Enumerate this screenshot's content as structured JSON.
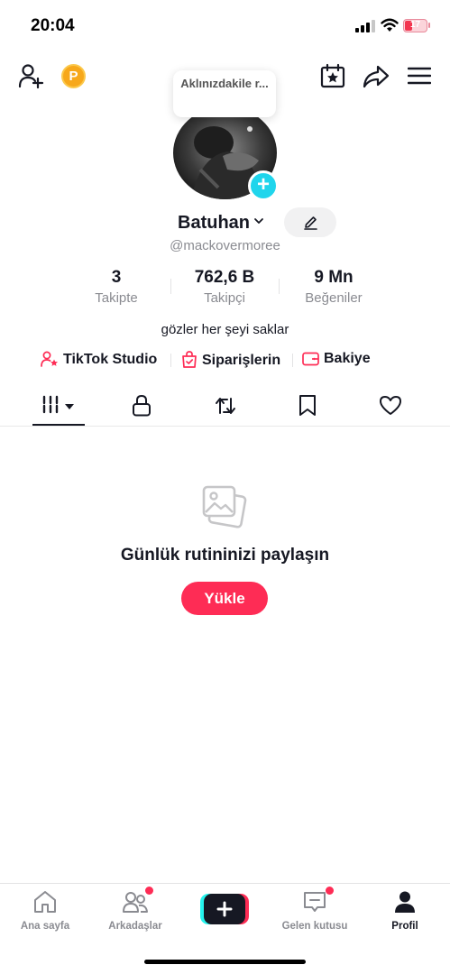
{
  "status_bar": {
    "time": "20:04",
    "battery": "17"
  },
  "header": {
    "coin_letter": "P"
  },
  "profile": {
    "note_bubble": "Aklınızdakile r...",
    "display_name": "Batuhan",
    "username": "@mackovermoree",
    "bio": "gözler her şeyi saklar"
  },
  "stats": [
    {
      "value": "3",
      "label": "Takipte"
    },
    {
      "value": "762,6 B",
      "label": "Takipçi"
    },
    {
      "value": "9 Mn",
      "label": "Beğeniler"
    }
  ],
  "links": [
    {
      "label": "TikTok Studio",
      "icon": "person-star-icon"
    },
    {
      "label": "Siparişlerin",
      "icon": "shopping-bag-icon"
    },
    {
      "label": "Bakiye",
      "icon": "wallet-icon"
    }
  ],
  "tabs": [
    {
      "name": "videos",
      "icon": "grid-bars-icon",
      "active": true
    },
    {
      "name": "private",
      "icon": "lock-icon"
    },
    {
      "name": "reposts",
      "icon": "repost-icon"
    },
    {
      "name": "saved",
      "icon": "bookmark-icon"
    },
    {
      "name": "liked",
      "icon": "heart-icon"
    }
  ],
  "empty_state": {
    "title": "Günlük rutininizi paylaşın",
    "button": "Yükle"
  },
  "bottom_nav": [
    {
      "label": "Ana sayfa",
      "icon": "home-icon"
    },
    {
      "label": "Arkadaşlar",
      "icon": "friends-icon",
      "badge": true
    },
    {
      "label": "",
      "icon": "create-plus-icon"
    },
    {
      "label": "Gelen kutusu",
      "icon": "inbox-icon",
      "badge": true
    },
    {
      "label": "Profil",
      "icon": "profile-icon",
      "active": true
    }
  ],
  "colors": {
    "accent": "#fe2c55",
    "badge_cyan": "#20d5ec",
    "coin": "#f7a81b"
  }
}
